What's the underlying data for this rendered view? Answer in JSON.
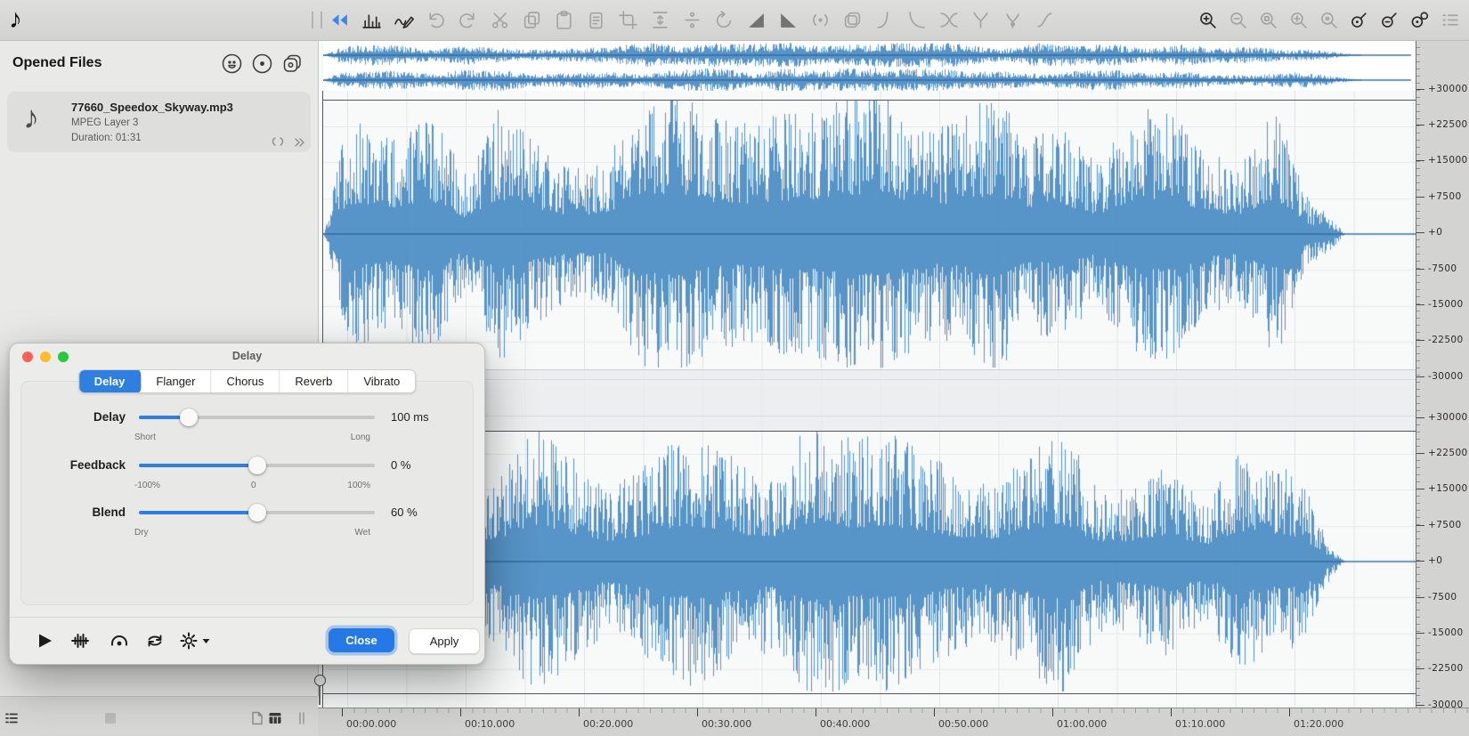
{
  "colors": {
    "accent": "#2e7fe0",
    "waveform": "#4e8ec5",
    "waveform_zero": "#2e689e",
    "grid_horizontal": "#e5e8ea",
    "traffic_red": "#ff5f57",
    "traffic_yellow": "#febc2e",
    "traffic_green": "#28c840"
  },
  "toolbar": {
    "icons_main": [
      "rewind",
      "spectrogram",
      "effects",
      "undo",
      "redo",
      "cut",
      "copy",
      "paste",
      "clipboard",
      "trim",
      "fit-vertical",
      "split",
      "rotate",
      "fade-in",
      "fade-out",
      "normalize",
      "duplicate",
      "curve-log",
      "curve-exp",
      "curve-cross",
      "curve-y",
      "curve-branch",
      "curve-s"
    ],
    "icons_zoom": [
      "zoom-in",
      "zoom-out",
      "zoom-selection",
      "zoom-fit",
      "zoom-original",
      "vertical-zoom-in",
      "vertical-zoom-out",
      "vertical-zoom-reset",
      "view-options"
    ]
  },
  "sidebar": {
    "title": "Opened Files",
    "header_icons": [
      "monitor",
      "record",
      "stack"
    ],
    "file": {
      "icon": "music-note",
      "name": "77660_Speedox_Skyway.mp3",
      "format": "MPEG Layer 3",
      "duration": "Duration: 01:31",
      "badges": [
        "repeat",
        "chevrons"
      ]
    }
  },
  "dialog": {
    "title": "Delay",
    "tabs": [
      {
        "label": "Delay",
        "active": true
      },
      {
        "label": "Flanger",
        "active": false
      },
      {
        "label": "Chorus",
        "active": false
      },
      {
        "label": "Reverb",
        "active": false
      },
      {
        "label": "Vibrato",
        "active": false
      }
    ],
    "sliders": [
      {
        "label": "Delay",
        "value": "100 ms",
        "range_labels": [
          "Short",
          "Long"
        ],
        "position_pct": 21
      },
      {
        "label": "Feedback",
        "value": "0 %",
        "range_labels": [
          "-100%",
          "0",
          "100%"
        ],
        "position_pct": 50
      },
      {
        "label": "Blend",
        "value": "60 %",
        "range_labels": [
          "Dry",
          "Wet"
        ],
        "position_pct": 50
      }
    ],
    "footer": {
      "icons": [
        "play",
        "preview-wave",
        "monitor",
        "loop",
        "settings",
        "dropdown"
      ],
      "buttons": [
        {
          "label": "Close",
          "primary": true
        },
        {
          "label": "Apply",
          "primary": false
        }
      ]
    }
  },
  "waveform_view": {
    "channels": 2,
    "scale_labels": [
      "+30000",
      "+22500",
      "+15000",
      "+7500",
      "+0",
      "-7500",
      "-15000",
      "-22500",
      "-30000"
    ],
    "timeline_labels": [
      "00:00.000",
      "00:10.000",
      "00:20.000",
      "00:30.000",
      "00:40.000",
      "00:50.000",
      "01:00.000",
      "01:10.000",
      "01:20.000"
    ]
  },
  "statusbar": {
    "icons": [
      "list",
      "placeholder",
      "file",
      "grid",
      "drag-handle"
    ]
  }
}
